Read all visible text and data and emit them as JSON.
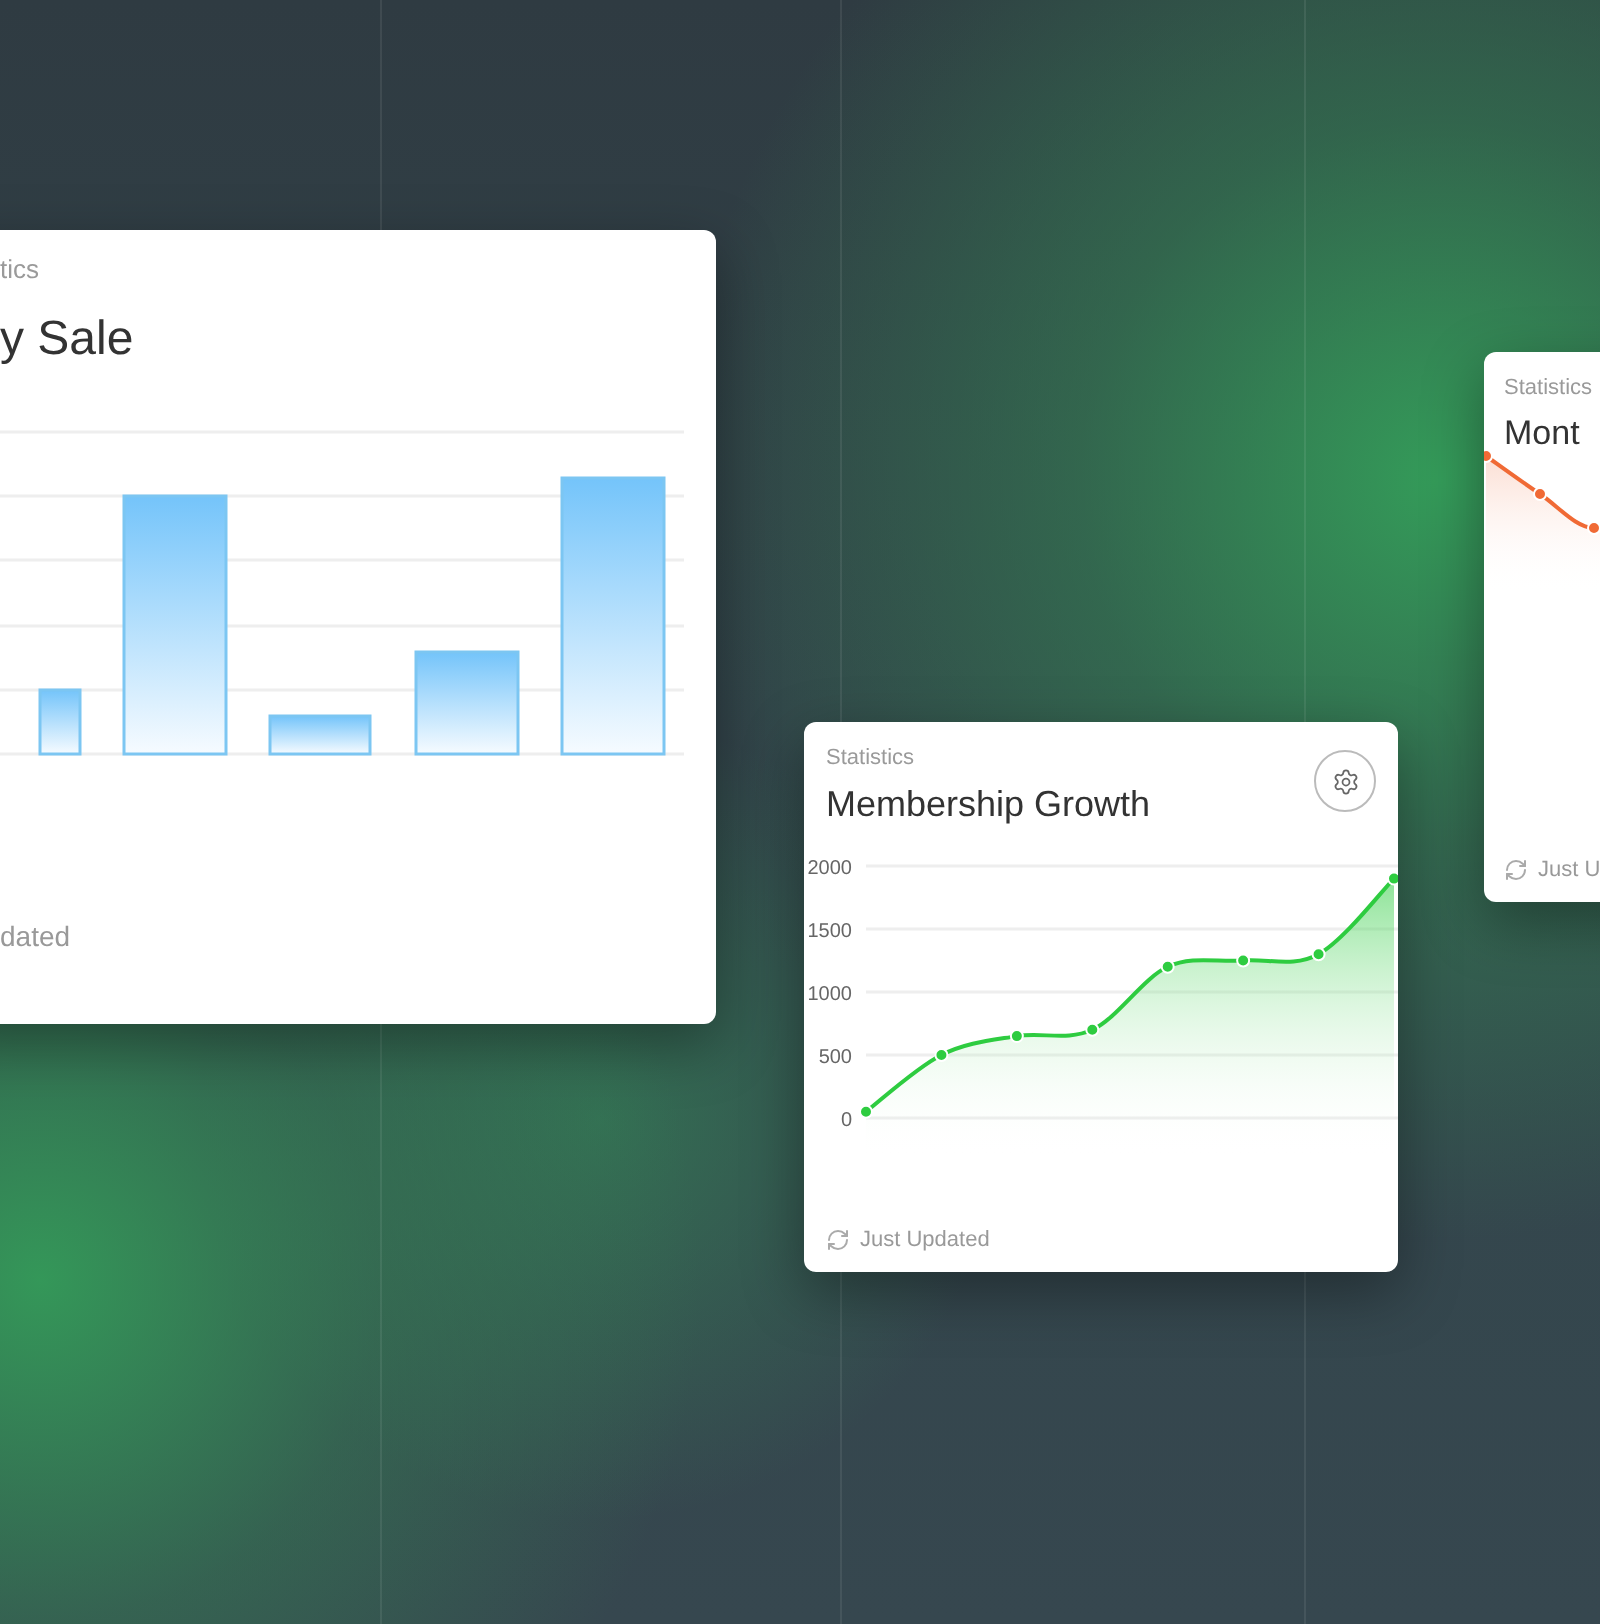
{
  "cards": [
    {
      "kind": "bar",
      "eyebrow": "tics",
      "title": "y Sale",
      "footer": "dated"
    },
    {
      "kind": "area",
      "eyebrow": "Statistics",
      "title": "Membership Growth",
      "settings": true,
      "footer": "Just Updated",
      "chart_data": {
        "type": "area",
        "grid": true,
        "series": [
          {
            "color": "#2ecc40",
            "values": [
              50,
              500,
              650,
              700,
              1200,
              1250,
              1300,
              1900
            ]
          }
        ],
        "ylim": [
          0,
          2000
        ],
        "yticks": [
          0,
          500,
          1000,
          1500,
          2000
        ]
      }
    },
    {
      "kind": "line",
      "eyebrow": "Statistics",
      "title": "Mont",
      "footer": "Just U"
    }
  ]
}
